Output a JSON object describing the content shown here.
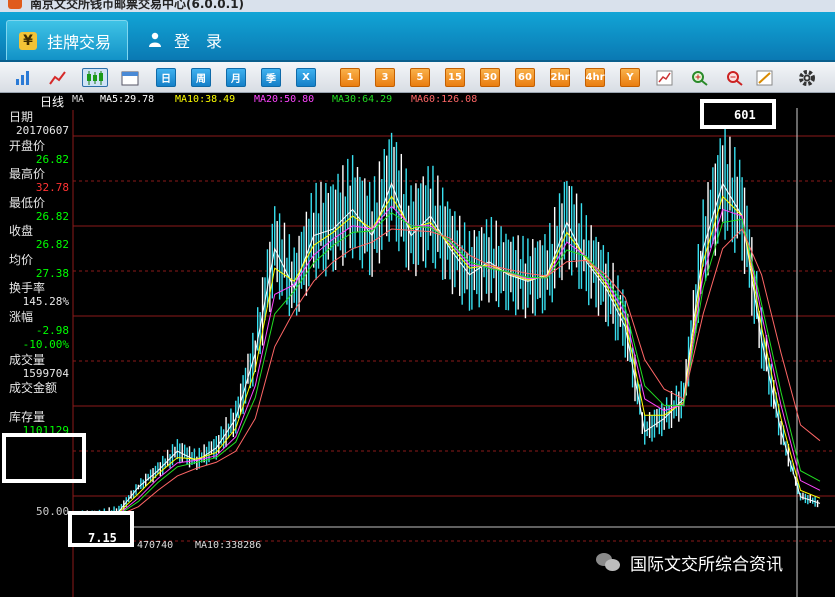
{
  "window": {
    "title": "南京文交所钱币邮票交易中心(6.0.0.1)"
  },
  "nav": {
    "tabs": [
      {
        "label": "挂牌交易",
        "icon": "yen-icon",
        "active": true
      },
      {
        "label": "登　录",
        "icon": "user-icon",
        "active": false
      }
    ]
  },
  "toolbar": {
    "tools": [
      {
        "name": "bar-chart-icon",
        "label": ""
      },
      {
        "name": "line-chart-icon",
        "label": ""
      },
      {
        "name": "candlestick-icon",
        "label": ""
      },
      {
        "name": "calendar-icon",
        "label": ""
      },
      {
        "name": "period-day",
        "label": "日"
      },
      {
        "name": "period-week",
        "label": "周"
      },
      {
        "name": "period-month",
        "label": "月"
      },
      {
        "name": "period-season",
        "label": "季"
      },
      {
        "name": "period-x",
        "label": "X"
      },
      {
        "name": "period-1min",
        "label": "1"
      },
      {
        "name": "period-3min",
        "label": "3"
      },
      {
        "name": "period-5min",
        "label": "5"
      },
      {
        "name": "period-15min",
        "label": "15"
      },
      {
        "name": "period-30min",
        "label": "30"
      },
      {
        "name": "period-60min",
        "label": "60"
      },
      {
        "name": "period-2hr",
        "label": "2hr"
      },
      {
        "name": "period-4hr",
        "label": "4hr"
      },
      {
        "name": "period-year",
        "label": "Y"
      },
      {
        "name": "indicator-icon",
        "label": ""
      },
      {
        "name": "zoom-in-icon",
        "label": ""
      },
      {
        "name": "zoom-out-icon",
        "label": ""
      },
      {
        "name": "draw-icon",
        "label": ""
      },
      {
        "name": "settings-icon",
        "label": ""
      }
    ]
  },
  "chart": {
    "period_label": "日线",
    "ma_prefix": "MA",
    "ma": [
      {
        "label": "MA5:29.78",
        "color": "#ffffff"
      },
      {
        "label": "MA10:38.49",
        "color": "#ffff00"
      },
      {
        "label": "MA20:50.80",
        "color": "#ff44ff"
      },
      {
        "label": "MA30:64.29",
        "color": "#22dd22"
      },
      {
        "label": "MA60:126.08",
        "color": "#ff6666"
      }
    ],
    "info_panel": [
      {
        "label": "日期",
        "value": "20170607",
        "color": "#e8e8e8"
      },
      {
        "label": "开盘价",
        "value": "26.82",
        "color": "#00ff00"
      },
      {
        "label": "最高价",
        "value": "32.78",
        "color": "#ff3333"
      },
      {
        "label": "最低价",
        "value": "26.82",
        "color": "#00ff00"
      },
      {
        "label": "收盘",
        "value": "26.82",
        "color": "#00ff00"
      },
      {
        "label": "均价",
        "value": "27.38",
        "color": "#00ff00"
      },
      {
        "label": "换手率",
        "value": "145.28%",
        "color": "#e8e8e8"
      },
      {
        "label": "涨幅",
        "value": "-2.98",
        "color": "#00ff00"
      },
      {
        "label": "",
        "value": "-10.00%",
        "color": "#00ff00"
      },
      {
        "label": "成交量",
        "value": "1599704",
        "color": "#e8e8e8"
      },
      {
        "label": "成交金额",
        "value": "",
        "color": "#e8e8e8"
      },
      {
        "label": "库存量",
        "value": "1101129",
        "color": "#00ff00"
      }
    ],
    "annotations": {
      "max_price": "601",
      "min_price": "7.15"
    },
    "axis_label": "50.00",
    "volume_bar": [
      {
        "label": "470740",
        "color": "#dddddd"
      },
      {
        "label": "MA10:338286",
        "color": "#dddddd"
      }
    ]
  },
  "watermark": {
    "text": "国际文交所综合资讯",
    "icon": "wechat-icon"
  },
  "chart_data": {
    "type": "line",
    "title": "",
    "xlabel": "",
    "ylabel": "",
    "ylim": [
      0,
      620
    ],
    "grid": true,
    "x": [
      0,
      20,
      40,
      60,
      80,
      100,
      120,
      140,
      160,
      180,
      200,
      220,
      240,
      260,
      280,
      300,
      320,
      340,
      360,
      380,
      400,
      420,
      440,
      460,
      480,
      500,
      520,
      540,
      560,
      580,
      600,
      620,
      640,
      660,
      680,
      700,
      720,
      740,
      760
    ],
    "series": [
      {
        "name": "MA5:29.78",
        "values": [
          10,
          12,
          18,
          55,
          80,
          110,
          95,
          115,
          160,
          260,
          420,
          360,
          440,
          450,
          480,
          440,
          520,
          440,
          470,
          420,
          380,
          400,
          380,
          370,
          380,
          460,
          400,
          360,
          300,
          140,
          160,
          190,
          420,
          520,
          470,
          280,
          140,
          40,
          30
        ]
      },
      {
        "name": "MA10:38.49",
        "values": [
          10,
          11,
          16,
          45,
          75,
          100,
          98,
          108,
          145,
          235,
          390,
          370,
          425,
          445,
          470,
          450,
          500,
          450,
          460,
          425,
          390,
          395,
          382,
          372,
          378,
          445,
          405,
          365,
          310,
          165,
          165,
          185,
          400,
          500,
          470,
          300,
          160,
          50,
          38
        ]
      },
      {
        "name": "MA20:50.80",
        "values": [
          10,
          10,
          14,
          38,
          68,
          92,
          96,
          103,
          132,
          210,
          350,
          365,
          410,
          435,
          455,
          450,
          485,
          455,
          455,
          430,
          395,
          392,
          383,
          374,
          376,
          430,
          408,
          370,
          320,
          190,
          172,
          182,
          380,
          480,
          470,
          320,
          180,
          65,
          50
        ]
      },
      {
        "name": "MA30:64.29",
        "values": [
          10,
          10,
          13,
          33,
          62,
          86,
          93,
          100,
          124,
          192,
          320,
          355,
          398,
          425,
          445,
          447,
          475,
          455,
          452,
          432,
          400,
          390,
          384,
          376,
          375,
          418,
          408,
          374,
          330,
          210,
          180,
          180,
          360,
          460,
          465,
          335,
          200,
          80,
          64
        ]
      },
      {
        "name": "MA60:126.08",
        "values": [
          10,
          10,
          12,
          25,
          50,
          72,
          84,
          93,
          110,
          160,
          270,
          325,
          370,
          400,
          420,
          430,
          450,
          448,
          446,
          436,
          410,
          395,
          388,
          382,
          378,
          400,
          402,
          380,
          345,
          250,
          205,
          190,
          320,
          420,
          450,
          380,
          260,
          150,
          126
        ]
      }
    ]
  }
}
